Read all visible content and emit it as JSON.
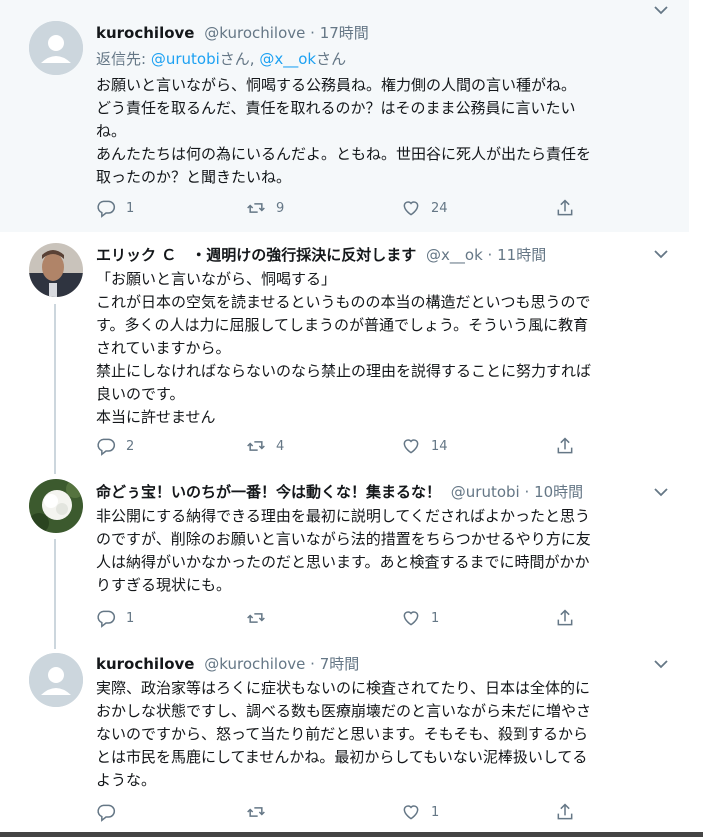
{
  "tweets": [
    {
      "name": "kurochilove",
      "handle": "@kurochilove",
      "time": "17時間",
      "reply_prefix": "返信先: ",
      "reply_user1": "@urutobi",
      "reply_sep": "さん, ",
      "reply_user2": "@x__ok",
      "reply_suffix": "さん",
      "lines": [
        "お願いと言いながら、恫喝する公務員ね。権力側の人間の言い種がね。",
        "どう責任を取るんだ、責任を取れるのか？はそのまま公務員に言いたい",
        "ね。",
        "あんたたちは何の為にいるんだよ。ともね。世田谷に死人が出たら責任を",
        "取ったのか？と聞きたいね。"
      ],
      "reply_count": "1",
      "retweet_count": "9",
      "like_count": "24"
    },
    {
      "name": "エリック Ｃ　・週明けの強行採決に反対します",
      "handle": "@x__ok",
      "time": "11時間",
      "lines": [
        "「お願いと言いながら、恫喝する」",
        "これが日本の空気を読ませるというものの本当の構造だといつも思うので",
        "す。多くの人は力に屈服してしまうのが普通でしょう。そういう風に教育",
        "されていますから。",
        "禁止にしなければならないのなら禁止の理由を説得することに努力すれば",
        "良いのです。",
        "本当に許せません"
      ],
      "reply_count": "2",
      "retweet_count": "4",
      "like_count": "14"
    },
    {
      "name": "命どぅ宝！いのちが一番！今は動くな！集まるな！",
      "handle": "@urutobi",
      "time": "10時間",
      "lines": [
        "非公開にする納得できる理由を最初に説明してくださればよかったと思う",
        "のですが、削除のお願いと言いながら法的措置をちらつかせるやり方に友",
        "人は納得がいかなかったのだと思います。あと検査するまでに時間がかか",
        "りすぎる現状にも。"
      ],
      "reply_count": "1",
      "retweet_count": "",
      "like_count": "1"
    },
    {
      "name": "kurochilove",
      "handle": "@kurochilove",
      "time": "7時間",
      "lines": [
        "実際、政治家等はろくに症状もないのに検査されてたり、日本は全体的に",
        "おかしな状態ですし、調べる数も医療崩壊だのと言いながら未だに増やさ",
        "ないのですから、怒って当たり前だと思います。そもそも、殺到するから",
        "とは市民を馬鹿にしてませんかね。最初からしてもいない泥棒扱いしてる",
        "ような。"
      ],
      "reply_count": "",
      "retweet_count": "",
      "like_count": "1"
    }
  ],
  "dot": "·",
  "icons": {
    "reply": "reply-icon",
    "retweet": "retweet-icon",
    "like": "heart-icon",
    "share": "share-icon",
    "caret": "chevron-down-icon"
  },
  "colors": {
    "link": "#1da1f2",
    "secondary": "#657786",
    "highlight_bg": "#f5f8fa"
  }
}
